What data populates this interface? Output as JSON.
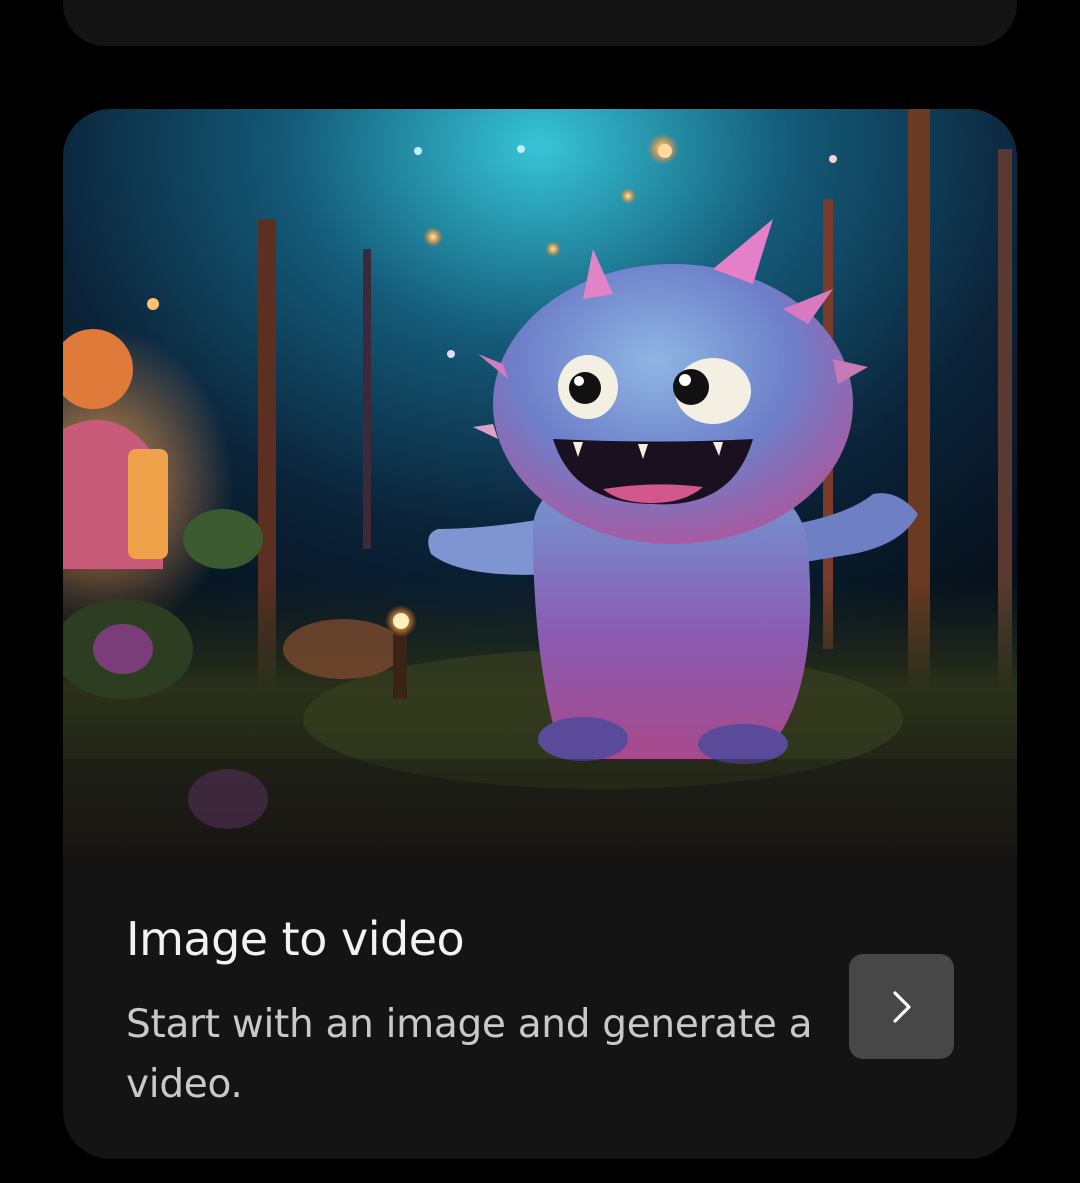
{
  "card": {
    "title": "Image to video",
    "description": "Start with an image and generate a video.",
    "image_alt": "Fluffy blue monster with pink spikes standing in a glowing night forest",
    "action_icon": "chevron-right-icon"
  },
  "colors": {
    "page_background": "#000000",
    "card_background": "#141414",
    "button_background": "#474747",
    "title_text": "#f2f2f2",
    "description_text": "#c9c9c9"
  }
}
